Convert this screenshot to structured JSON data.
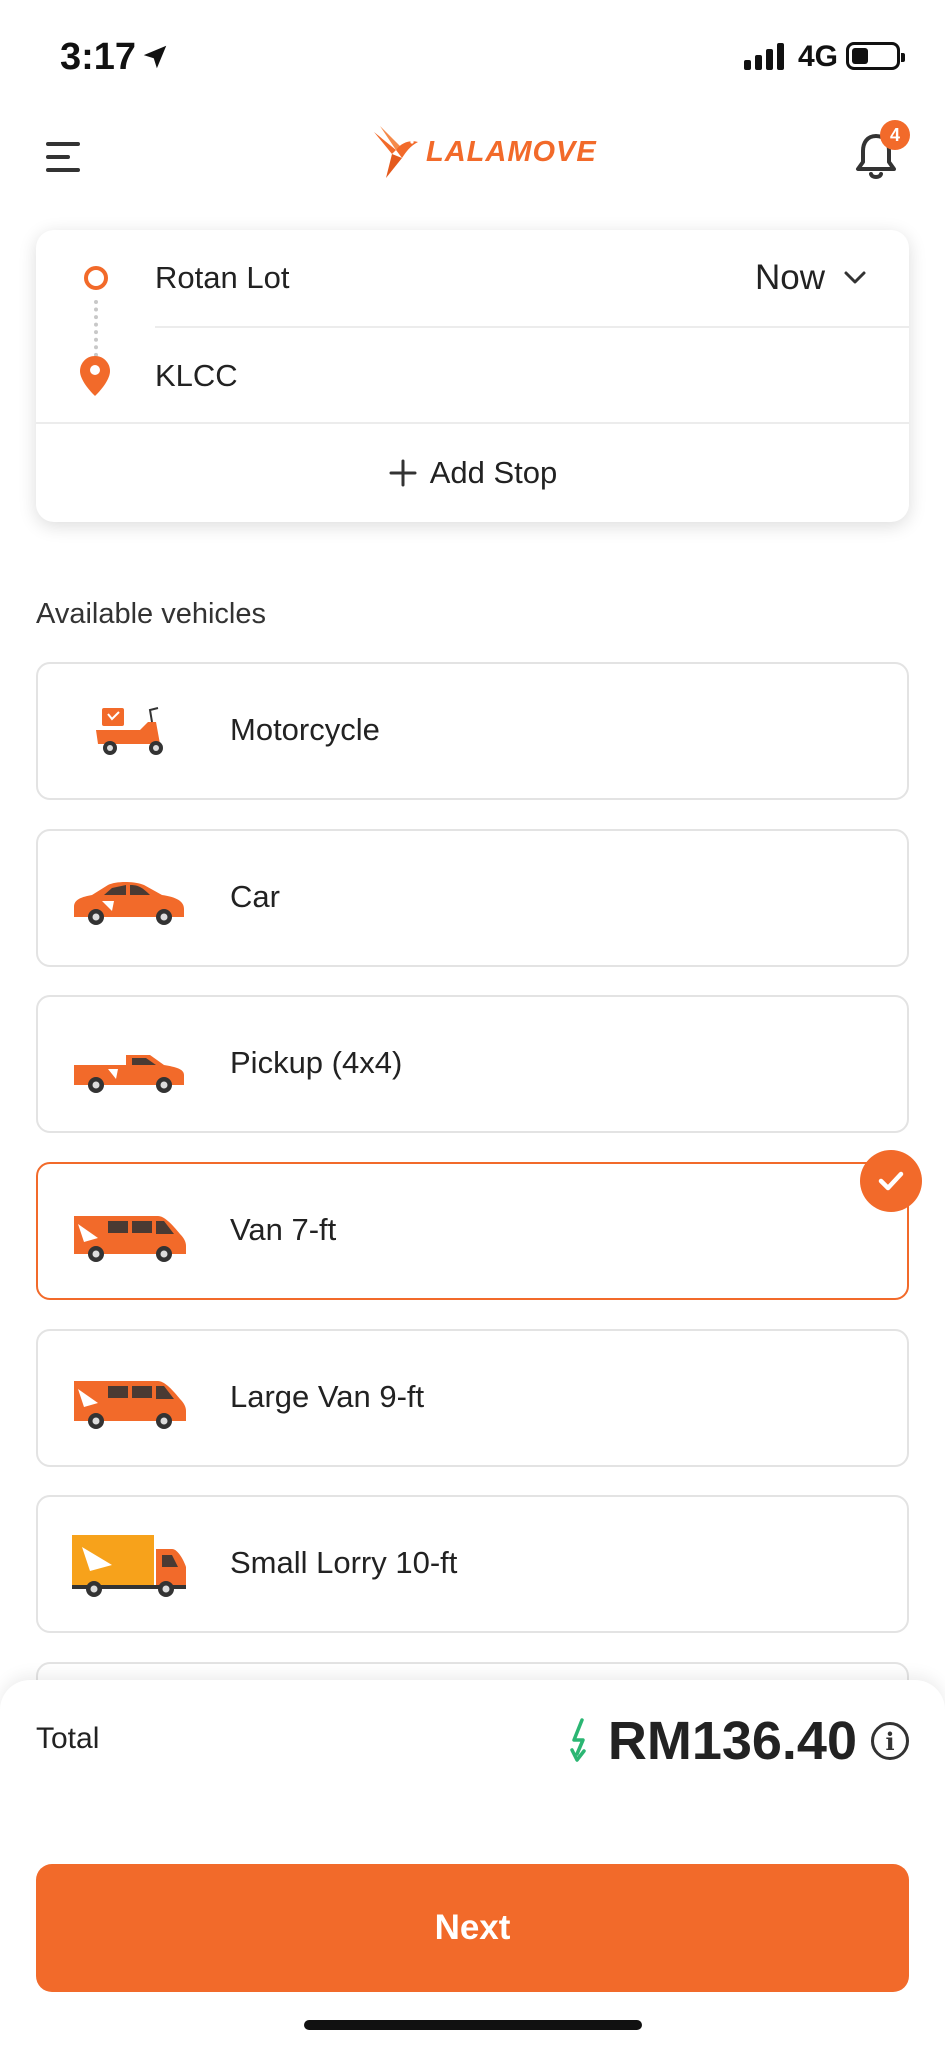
{
  "status_bar": {
    "time": "3:17",
    "network": "4G"
  },
  "header": {
    "logo_text": "LALAMOVE",
    "notification_count": "4"
  },
  "route": {
    "pickup": "Rotan Lot",
    "dropoff": "KLCC",
    "time_option": "Now",
    "add_stop_label": "Add Stop"
  },
  "vehicles": {
    "section_title": "Available vehicles",
    "items": [
      {
        "name": "Motorcycle",
        "icon": "motorcycle-icon",
        "selected": false
      },
      {
        "name": "Car",
        "icon": "car-icon",
        "selected": false
      },
      {
        "name": "Pickup (4x4)",
        "icon": "pickup-truck-icon",
        "selected": false
      },
      {
        "name": "Van 7-ft",
        "icon": "van-icon",
        "selected": true
      },
      {
        "name": "Large Van 9-ft",
        "icon": "large-van-icon",
        "selected": false
      },
      {
        "name": "Small Lorry 10-ft",
        "icon": "lorry-icon",
        "selected": false
      }
    ]
  },
  "footer": {
    "total_label": "Total",
    "price": "RM136.40",
    "next_label": "Next"
  },
  "colors": {
    "brand": "#f26a2a",
    "price_icon": "#2bb673"
  }
}
